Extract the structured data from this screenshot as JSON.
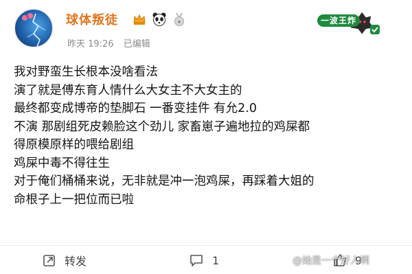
{
  "post": {
    "username": "球体叛徒",
    "meta": {
      "time": "昨天 19:26",
      "edited": "已编辑"
    },
    "badge_label": "一波王炸",
    "lines": [
      "我对野蛮生长根本没啥看法",
      "演了就是傅东育人情什么大女主不大女主的",
      "最终都变成博帝的垫脚石 一番变挂件 有允2.0",
      "不演 那剧组死皮赖脸这个劲儿 家畜崽子遍地拉的鸡屎都",
      "得原模原样的喂给剧组",
      "鸡屎中毒不得往生",
      "对于俺们桶桶来说，无非就是冲一泡鸡屎，再踩着大姐的",
      "命根子上一把位而已啦"
    ],
    "actions": {
      "share": "转发",
      "comments": "1",
      "likes": "9"
    },
    "watermark": "@她是一个好人啊"
  },
  "colors": {
    "username": "#e0751f",
    "badge": "#1e8a3e",
    "meta": "#8a8a8a"
  },
  "icons": [
    "crown-icon",
    "panda-icon",
    "medal-icon",
    "share-icon",
    "comment-icon",
    "like-icon"
  ]
}
